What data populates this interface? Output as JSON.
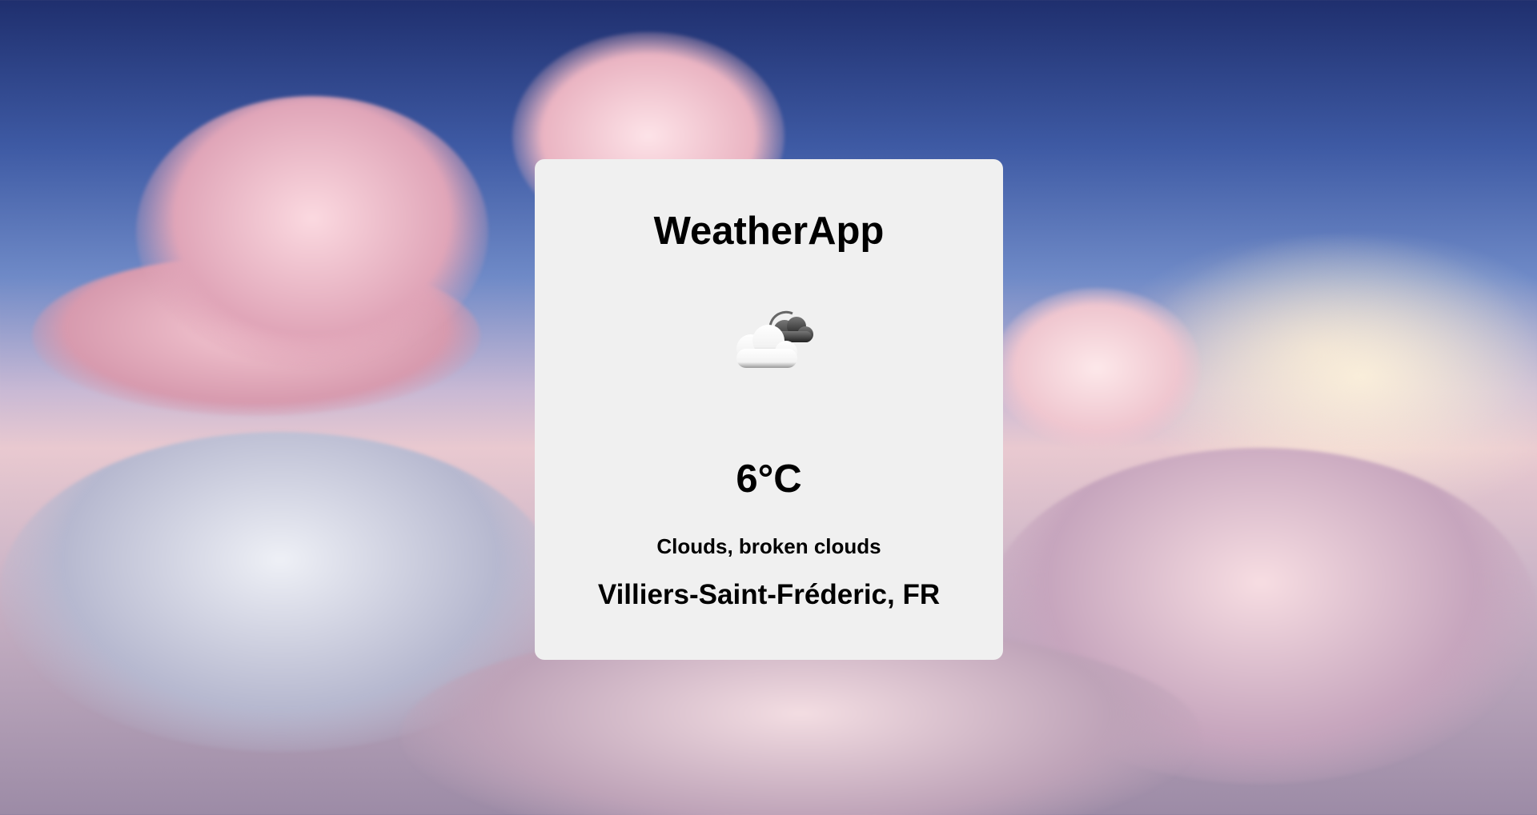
{
  "app": {
    "title": "WeatherApp"
  },
  "weather": {
    "icon": "broken-clouds-icon",
    "temperature": "6°C",
    "description": "Clouds, broken clouds",
    "location": "Villiers-Saint-Fréderic, FR"
  },
  "colors": {
    "card_background": "#f0f0f0",
    "text": "#000000"
  }
}
